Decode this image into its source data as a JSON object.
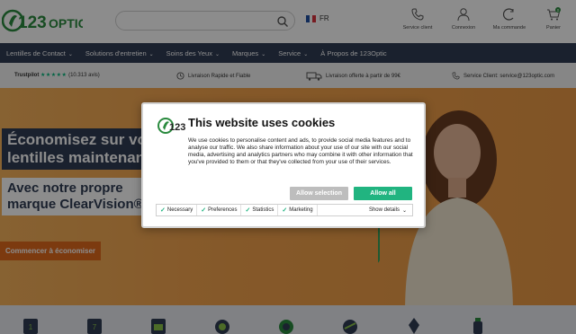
{
  "header": {
    "logo_text": "123OPTIC",
    "language": "FR",
    "actions": [
      {
        "label": "Service client",
        "icon": "phone-icon"
      },
      {
        "label": "Connexion",
        "icon": "user-icon"
      },
      {
        "label": "Ma commande",
        "icon": "order-icon"
      },
      {
        "label": "Panier",
        "icon": "cart-icon",
        "badge": "0"
      }
    ]
  },
  "nav": {
    "items": [
      {
        "label": "Lentilles de Contact",
        "dropdown": true
      },
      {
        "label": "Solutions d'entretien",
        "dropdown": true
      },
      {
        "label": "Soins des Yeux",
        "dropdown": true
      },
      {
        "label": "Marques",
        "dropdown": true
      },
      {
        "label": "Service",
        "dropdown": true
      },
      {
        "label": "À Propos de 123Optic",
        "dropdown": false
      }
    ]
  },
  "trust_bar": {
    "trustpilot_label": "Trustpilot",
    "stars": "★★★★★",
    "reviews": "(10.313 avis)",
    "usp1": "Livraison Rapide et Fiable",
    "usp2": "Livraison offerte à partir de 99€",
    "usp3": "Service Client: service@123optic.com"
  },
  "hero": {
    "title": "Économisez sur vos lentilles maintenant!",
    "subtitle": "Avec notre propre marque ClearVision®",
    "cta": "Commencer à économiser"
  },
  "cookie_dialog": {
    "title": "This website uses cookies",
    "body": "We use cookies to personalise content and ads, to provide social media features and to analyse our traffic. We also share information about your use of our site with our social media, advertising and analytics partners who may combine it with other information that you've provided to them or that they've collected from your use of their services.",
    "allow_selection": "Allow selection",
    "allow_all": "Allow all",
    "consents": [
      "Necessary",
      "Preferences",
      "Statistics",
      "Marketing"
    ],
    "show_details": "Show details"
  },
  "colors": {
    "nav_bg": "#303d55",
    "brand_green": "#21b480",
    "hero_orange": "#f2a14a",
    "cta_orange": "#e26a1c"
  }
}
